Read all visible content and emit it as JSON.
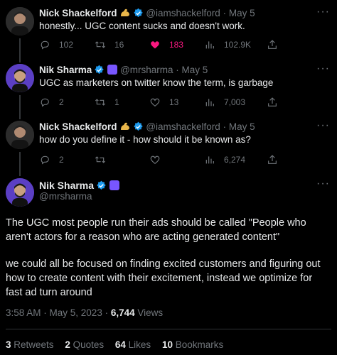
{
  "tweets": [
    {
      "name": "Nick Shackelford",
      "handle": "@iamshackelford",
      "date": "· May 5",
      "text": "honestly... UGC content sucks and doesn't work.",
      "replies": "102",
      "retweets": "16",
      "likes": "183",
      "views": "102.9K"
    },
    {
      "name": "Nik Sharma",
      "handle": "@mrsharma",
      "date": "· May 5",
      "text": "UGC as marketers on twitter know the term, is garbage",
      "replies": "2",
      "retweets": "1",
      "likes": "13",
      "views": "7,003"
    },
    {
      "name": "Nick Shackelford",
      "handle": "@iamshackelford",
      "date": "· May 5",
      "text": "how do you define it - how should it be known as?",
      "replies": "2",
      "retweets": "",
      "likes": "",
      "views": "6,274"
    }
  ],
  "main": {
    "name": "Nik Sharma",
    "handle": "@mrsharma",
    "paragraph1": "The UGC most people run their ads should be called  \"People who aren't actors for a reason who are acting generated content\"",
    "paragraph2": "we could all be focused on finding excited customers and figuring out how to create content with their excitement, instead we optimize for fast ad turn around",
    "time": "3:58 AM · May 5, 2023 · ",
    "views_count": "6,744",
    "views_label": " Views",
    "stats": {
      "retweets_count": "3",
      "retweets_label": " Retweets",
      "quotes_count": "2",
      "quotes_label": " Quotes",
      "likes_count": "64",
      "likes_label": " Likes",
      "bookmarks_count": "10",
      "bookmarks_label": " Bookmarks"
    }
  },
  "colors": {
    "background": "#000000",
    "text": "#e7e9ea",
    "muted": "#71767b",
    "like": "#f91880",
    "verified": "#1d9bf0"
  },
  "icons": {
    "reply": "reply-icon",
    "retweet": "retweet-icon",
    "like": "heart-icon",
    "views": "views-icon",
    "more": "more-icon"
  }
}
